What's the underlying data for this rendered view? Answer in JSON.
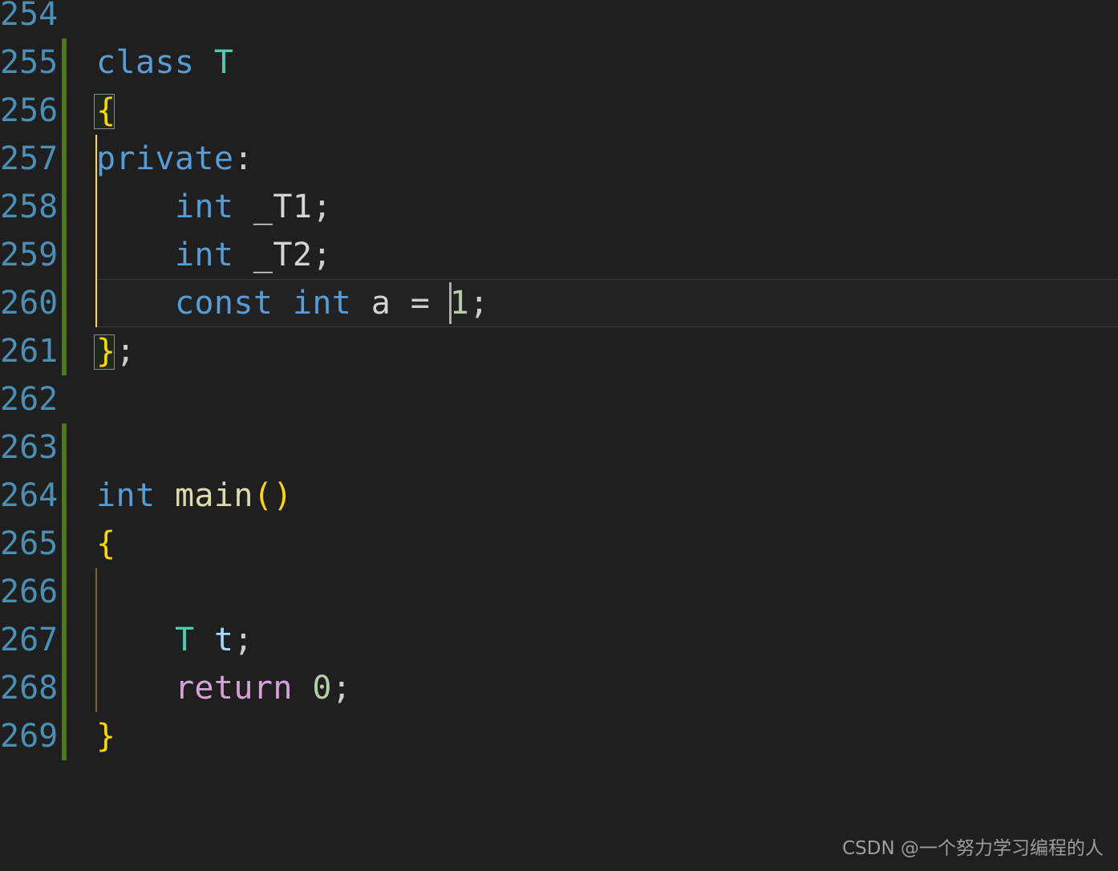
{
  "editor": {
    "background_color": "#1f1f1f",
    "line_number_color": "#4a8fb5",
    "current_line": 260,
    "change_bar_color": "#4e7a1f",
    "active_indent_guide_color": "#ffd83d",
    "first_line": 254,
    "last_line": 269
  },
  "lines": [
    {
      "number": "254",
      "tokens": []
    },
    {
      "number": "255",
      "tokens": [
        {
          "text": "class ",
          "kind": "keyword"
        },
        {
          "text": "T",
          "kind": "type"
        }
      ]
    },
    {
      "number": "256",
      "tokens": [
        {
          "text": "{",
          "kind": "brace"
        }
      ]
    },
    {
      "number": "257",
      "tokens": [
        {
          "text": "private",
          "kind": "keyword"
        },
        {
          "text": ":",
          "kind": "punctuation"
        }
      ]
    },
    {
      "number": "258",
      "tokens": [
        {
          "text": "    ",
          "kind": "plain"
        },
        {
          "text": "int",
          "kind": "keyword"
        },
        {
          "text": " ",
          "kind": "plain"
        },
        {
          "text": "_T1",
          "kind": "identifier"
        },
        {
          "text": ";",
          "kind": "punctuation"
        }
      ]
    },
    {
      "number": "259",
      "tokens": [
        {
          "text": "    ",
          "kind": "plain"
        },
        {
          "text": "int",
          "kind": "keyword"
        },
        {
          "text": " ",
          "kind": "plain"
        },
        {
          "text": "_T2",
          "kind": "identifier"
        },
        {
          "text": ";",
          "kind": "punctuation"
        }
      ]
    },
    {
      "number": "260",
      "tokens": [
        {
          "text": "    ",
          "kind": "plain"
        },
        {
          "text": "const",
          "kind": "keyword"
        },
        {
          "text": " ",
          "kind": "plain"
        },
        {
          "text": "int",
          "kind": "keyword"
        },
        {
          "text": " ",
          "kind": "plain"
        },
        {
          "text": "a",
          "kind": "identifier"
        },
        {
          "text": " ",
          "kind": "plain"
        },
        {
          "text": "=",
          "kind": "punctuation"
        },
        {
          "text": " ",
          "kind": "plain"
        },
        {
          "text": "1",
          "kind": "number"
        },
        {
          "text": ";",
          "kind": "punctuation"
        }
      ]
    },
    {
      "number": "261",
      "tokens": [
        {
          "text": "}",
          "kind": "brace"
        },
        {
          "text": ";",
          "kind": "punctuation"
        }
      ]
    },
    {
      "number": "262",
      "tokens": []
    },
    {
      "number": "263",
      "tokens": []
    },
    {
      "number": "264",
      "tokens": [
        {
          "text": "int",
          "kind": "keyword"
        },
        {
          "text": " ",
          "kind": "plain"
        },
        {
          "text": "main",
          "kind": "function"
        },
        {
          "text": "()",
          "kind": "brace"
        }
      ]
    },
    {
      "number": "265",
      "tokens": [
        {
          "text": "{",
          "kind": "brace"
        }
      ]
    },
    {
      "number": "266",
      "tokens": []
    },
    {
      "number": "267",
      "tokens": [
        {
          "text": "    ",
          "kind": "plain"
        },
        {
          "text": "T",
          "kind": "type"
        },
        {
          "text": " ",
          "kind": "plain"
        },
        {
          "text": "t",
          "kind": "variable"
        },
        {
          "text": ";",
          "kind": "punctuation"
        }
      ]
    },
    {
      "number": "268",
      "tokens": [
        {
          "text": "    ",
          "kind": "plain"
        },
        {
          "text": "return",
          "kind": "control"
        },
        {
          "text": " ",
          "kind": "plain"
        },
        {
          "text": "0",
          "kind": "number"
        },
        {
          "text": ";",
          "kind": "punctuation"
        }
      ]
    },
    {
      "number": "269",
      "tokens": [
        {
          "text": "}",
          "kind": "brace"
        }
      ]
    }
  ],
  "watermark": {
    "text": "CSDN @一个努力学习编程的人"
  }
}
